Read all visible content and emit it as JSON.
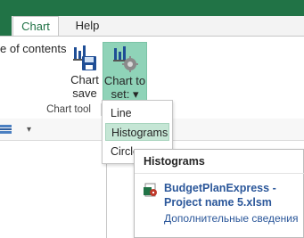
{
  "tabs": {
    "chart": "Chart",
    "help": "Help"
  },
  "ribbon": {
    "toc_label": "e of contents",
    "chart_save": {
      "line1": "Chart",
      "line2": "save"
    },
    "chart_to_set": {
      "line1": "Chart to",
      "line2": "set: ▾"
    },
    "group_label": "Chart tool"
  },
  "toolbar": {
    "dropdown_glyph": "▾"
  },
  "menu": {
    "items": [
      "Line",
      "Histograms",
      "Circle"
    ],
    "selected_index": 1
  },
  "tooltip": {
    "title": "Histograms",
    "file": "BudgetPlanExpress - Project name 5.xlsm",
    "more": "Дополнительные сведения"
  },
  "colors": {
    "accent": "#217346",
    "menu_selected": "#c5e6d5",
    "button_active": "#8fd3b8",
    "link": "#2b579a"
  }
}
